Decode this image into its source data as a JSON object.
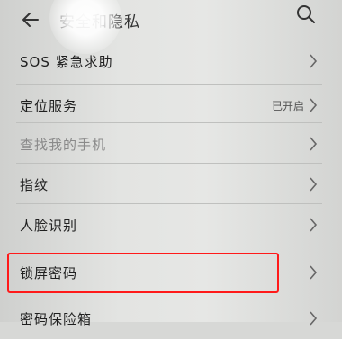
{
  "header": {
    "title": "安全和隐私"
  },
  "rows": [
    {
      "label": "SOS 紧急求助",
      "value": ""
    },
    {
      "label": "定位服务",
      "value": "已开启"
    },
    {
      "label": "查找我的手机",
      "value": ""
    },
    {
      "label": "指纹",
      "value": ""
    },
    {
      "label": "人脸识别",
      "value": ""
    },
    {
      "label": "锁屏密码",
      "value": ""
    },
    {
      "label": "密码保险箱",
      "value": ""
    }
  ],
  "icons": {
    "back": "back-arrow-icon",
    "search": "search-icon",
    "chevron": "chevron-right-icon"
  },
  "colors": {
    "highlight": "#ff1a1a"
  }
}
